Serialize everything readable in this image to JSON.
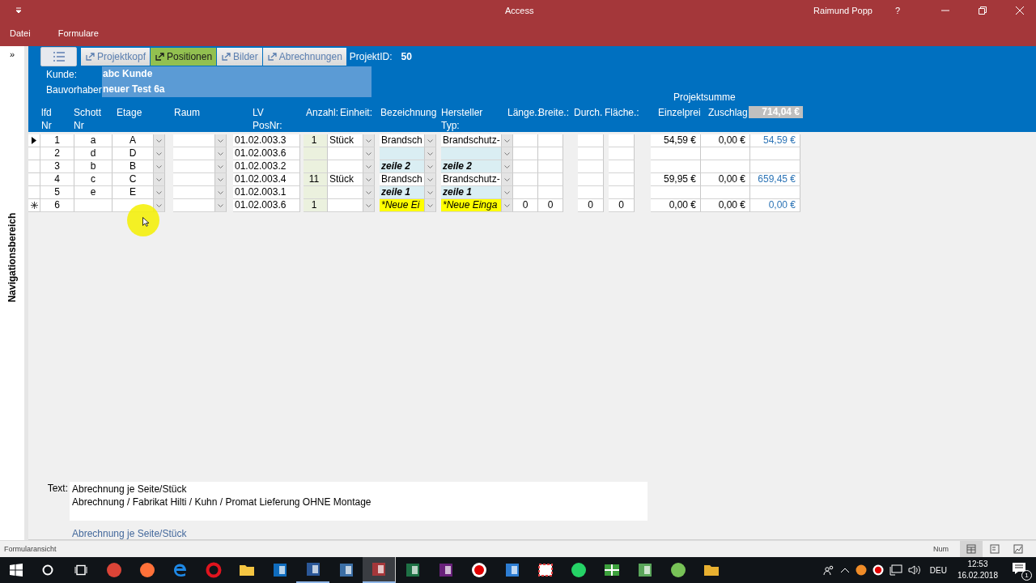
{
  "window": {
    "title": "Access",
    "user": "Raimund Popp",
    "help": "?"
  },
  "menu": [
    {
      "label": "Datei"
    },
    {
      "label": "Formulare"
    }
  ],
  "navigation_pane": {
    "label": "Navigationsbereich",
    "toggle": "»"
  },
  "form_tabs": [
    {
      "label": "Projektkopf",
      "selected": false
    },
    {
      "label": "Positionen",
      "selected": true
    },
    {
      "label": "Bilder",
      "selected": false
    },
    {
      "label": "Abrechnungen",
      "selected": false
    }
  ],
  "project_id": {
    "label": "ProjektID:",
    "value": "50"
  },
  "customer": {
    "label": "Kunde:",
    "value": "abc Kunde"
  },
  "construction": {
    "label": "Bauvorhaber",
    "value": "neuer Test 6a"
  },
  "project_sum": {
    "label": "Projektsumme",
    "value": "714,04 €"
  },
  "columns": [
    {
      "label": "lfd\nNr"
    },
    {
      "label": "Schott\nNr"
    },
    {
      "label": "Etage"
    },
    {
      "label": "Raum"
    },
    {
      "label": "LV\nPosNr:"
    },
    {
      "label": "Anzahl:"
    },
    {
      "label": "Einheit:"
    },
    {
      "label": "Bezeichnung"
    },
    {
      "label": "Hersteller\nTyp:"
    },
    {
      "label": "Länge.:"
    },
    {
      "label": "Breite.:"
    },
    {
      "label": "Durch."
    },
    {
      "label": "Fläche.:"
    },
    {
      "label": "Einzelprei"
    },
    {
      "label": "Zuschlag"
    }
  ],
  "rows": [
    {
      "kind": "record",
      "current": true,
      "highlight": false,
      "emphasis": false,
      "cells": [
        "1",
        "a",
        "A",
        null,
        "01.02.003.3",
        "1",
        "Stück",
        "Brandsch",
        "Brandschutz-",
        null,
        null,
        null,
        null,
        "54,59 €",
        "0,00 €",
        "54,59 €"
      ]
    },
    {
      "kind": "record",
      "current": false,
      "highlight": true,
      "emphasis": false,
      "cells": [
        "2",
        "d",
        "D",
        null,
        "01.02.003.6",
        null,
        null,
        null,
        null,
        null,
        null,
        null,
        null,
        null,
        null,
        null
      ]
    },
    {
      "kind": "record",
      "current": false,
      "highlight": true,
      "emphasis": true,
      "cells": [
        "3",
        "b",
        "B",
        null,
        "01.02.003.2",
        null,
        null,
        "zeile 2",
        "zeile 2",
        null,
        null,
        null,
        null,
        null,
        null,
        null
      ]
    },
    {
      "kind": "record",
      "current": false,
      "highlight": false,
      "emphasis": false,
      "cells": [
        "4",
        "c",
        "C",
        null,
        "01.02.003.4",
        "11",
        "Stück",
        "Brandsch",
        "Brandschutz-",
        null,
        null,
        null,
        null,
        "59,95 €",
        "0,00 €",
        "659,45 €"
      ]
    },
    {
      "kind": "record",
      "current": false,
      "highlight": true,
      "emphasis": true,
      "cells": [
        "5",
        "e",
        "E",
        null,
        "01.02.003.1",
        null,
        null,
        "zeile 1",
        "zeile 1",
        null,
        null,
        null,
        null,
        null,
        null,
        null
      ]
    },
    {
      "kind": "new",
      "current": false,
      "highlight": false,
      "emphasis": false,
      "cells": [
        "6",
        null,
        null,
        null,
        "01.02.003.6",
        "1",
        null,
        "*Neue Ei",
        "*Neue Einga",
        "0",
        "0",
        "0",
        "0",
        "0,00 €",
        "0,00 €",
        "0,00 €"
      ]
    }
  ],
  "text_field": {
    "label": "Text:",
    "lines": [
      "Abrechnung je Seite/Stück",
      "Abrechnung / Fabrikat Hilti / Kuhn / Promat Lieferung OHNE Montage"
    ],
    "link": "Abrechnung je Seite/Stück"
  },
  "status_bar": {
    "mode": "Formularansicht",
    "num": "Num",
    "views": [
      {
        "selected": true
      },
      {
        "selected": false
      },
      {
        "selected": false
      }
    ]
  },
  "taskbar": {
    "apps": [
      {
        "running": false,
        "selected": false
      },
      {
        "running": false,
        "selected": false
      },
      {
        "running": false,
        "selected": false
      },
      {
        "running": false,
        "selected": false
      },
      {
        "running": false,
        "selected": false
      },
      {
        "running": false,
        "selected": false
      },
      {
        "running": true,
        "selected": false
      },
      {
        "running": false,
        "selected": false
      },
      {
        "running": true,
        "selected": true
      },
      {
        "running": false,
        "selected": false
      },
      {
        "running": false,
        "selected": false
      },
      {
        "running": false,
        "selected": false
      },
      {
        "running": false,
        "selected": false
      },
      {
        "running": false,
        "selected": false
      },
      {
        "running": false,
        "selected": false
      },
      {
        "running": false,
        "selected": false
      },
      {
        "running": false,
        "selected": false
      },
      {
        "running": false,
        "selected": false
      },
      {
        "running": false,
        "selected": false
      }
    ],
    "language": "DEU",
    "time": "12:53",
    "date": "16.02.2018",
    "notifications": "1"
  }
}
